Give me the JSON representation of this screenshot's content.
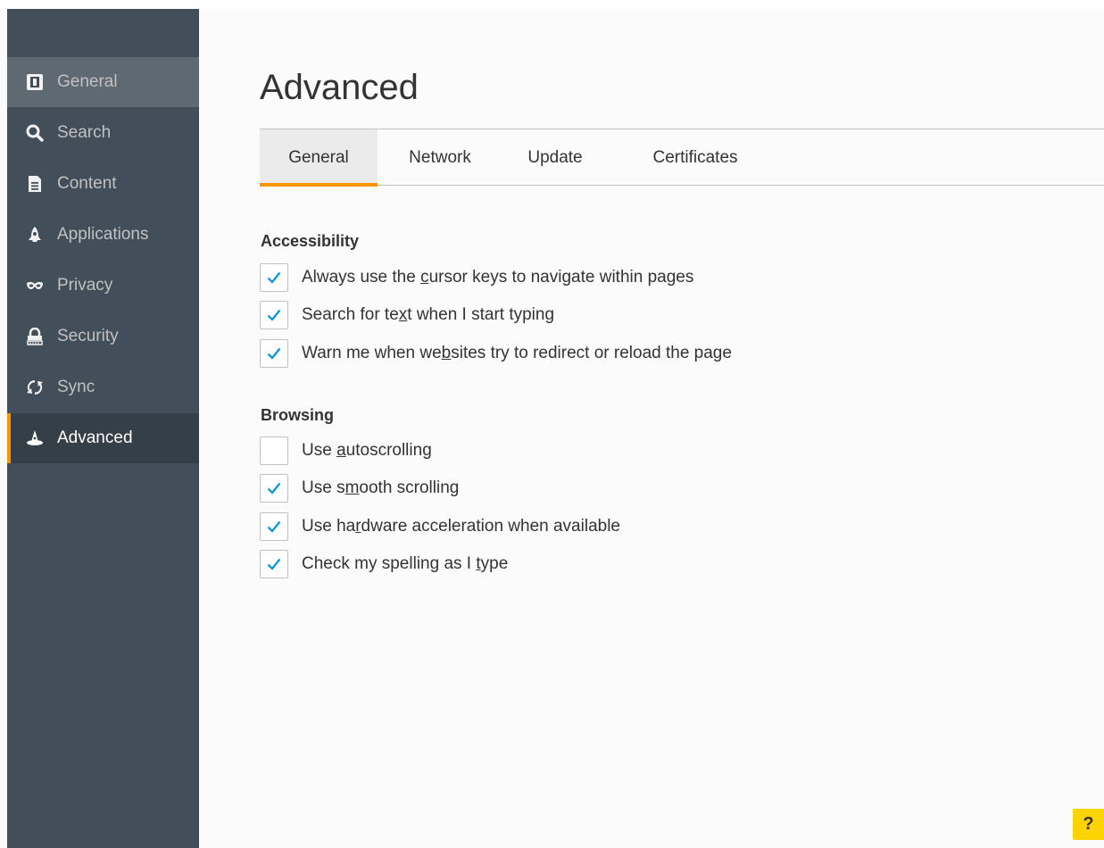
{
  "sidebar": {
    "items": [
      {
        "label": "General",
        "icon": "general-icon"
      },
      {
        "label": "Search",
        "icon": "search-icon"
      },
      {
        "label": "Content",
        "icon": "content-icon"
      },
      {
        "label": "Applications",
        "icon": "applications-icon"
      },
      {
        "label": "Privacy",
        "icon": "privacy-mask-icon"
      },
      {
        "label": "Security",
        "icon": "security-lock-icon"
      },
      {
        "label": "Sync",
        "icon": "sync-icon"
      },
      {
        "label": "Advanced",
        "icon": "advanced-wizard-hat-icon"
      }
    ],
    "selected": "Advanced",
    "hovered": "General"
  },
  "main": {
    "title": "Advanced",
    "tabs": [
      {
        "label": "General"
      },
      {
        "label": "Network"
      },
      {
        "label": "Update"
      },
      {
        "label": "Certificates"
      }
    ],
    "selected_tab": "General",
    "sections": [
      {
        "heading": "Accessibility",
        "options": [
          {
            "pre": "Always use the ",
            "key": "c",
            "post": "ursor keys to navigate within pages",
            "checked": true
          },
          {
            "pre": "Search for te",
            "key": "x",
            "post": "t when I start typing",
            "checked": true
          },
          {
            "pre": "Warn me when we",
            "key": "b",
            "post": "sites try to redirect or reload the page",
            "checked": true
          }
        ]
      },
      {
        "heading": "Browsing",
        "options": [
          {
            "pre": "Use ",
            "key": "a",
            "post": "utoscrolling",
            "checked": false
          },
          {
            "pre": "Use s",
            "key": "m",
            "post": "ooth scrolling",
            "checked": true
          },
          {
            "pre": "Use ha",
            "key": "r",
            "post": "dware acceleration when available",
            "checked": true
          },
          {
            "pre": "Check my spelling as I ",
            "key": "t",
            "post": "ype",
            "checked": true
          }
        ]
      }
    ]
  },
  "help": {
    "label": "?"
  },
  "colors": {
    "sidebar_bg": "#424f5a",
    "sidebar_selected_bg": "#343f48",
    "accent": "#ff9500",
    "checkmark": "#0095dd",
    "help_bg": "#fed400"
  }
}
